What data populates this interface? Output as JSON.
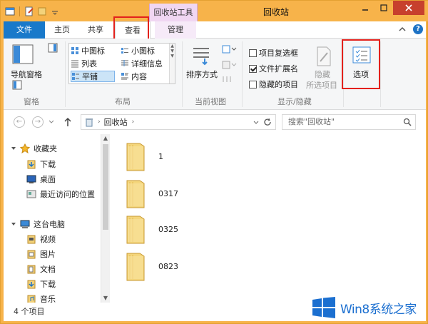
{
  "window": {
    "title": "回收站",
    "contextual_tab_group": "回收站工具",
    "accent": "#1979ca",
    "titlebar_color": "#f7b34a"
  },
  "tabs": [
    {
      "label": "文件"
    },
    {
      "label": "主页"
    },
    {
      "label": "共享"
    },
    {
      "label": "查看"
    },
    {
      "label": "管理"
    }
  ],
  "ribbon": {
    "panes": {
      "nav_pane_label": "导航窗格",
      "group_label": "窗格"
    },
    "layout": {
      "group_label": "布局",
      "items": [
        "中图标",
        "小图标",
        "列表",
        "详细信息",
        "平铺",
        "内容"
      ],
      "selected": "平铺"
    },
    "current_view": {
      "sort_label": "排序方式",
      "group_label": "当前视图"
    },
    "show_hide": {
      "group_label": "显示/隐藏",
      "item_checkboxes": {
        "label": "项目复选框",
        "checked": false
      },
      "file_extensions": {
        "label": "文件扩展名",
        "checked": true
      },
      "hidden_items": {
        "label": "隐藏的项目",
        "checked": false
      },
      "hide_label": "隐藏",
      "hide_selected_label": "所选项目"
    },
    "options_label": "选项"
  },
  "address": {
    "path": "回收站",
    "search_placeholder": "搜索\"回收站\""
  },
  "nav": {
    "favorites": {
      "label": "收藏夹",
      "items": [
        "下载",
        "桌面",
        "最近访问的位置"
      ]
    },
    "this_pc": {
      "label": "这台电脑",
      "items": [
        "视频",
        "图片",
        "文档",
        "下载",
        "音乐"
      ]
    }
  },
  "files": [
    {
      "name": "1"
    },
    {
      "name": "0317"
    },
    {
      "name": "0325"
    },
    {
      "name": "0823"
    }
  ],
  "status": {
    "count_text": "4 个项目"
  },
  "watermark": {
    "text": "Win8系统之家"
  },
  "highlight_color": "#e3211c"
}
